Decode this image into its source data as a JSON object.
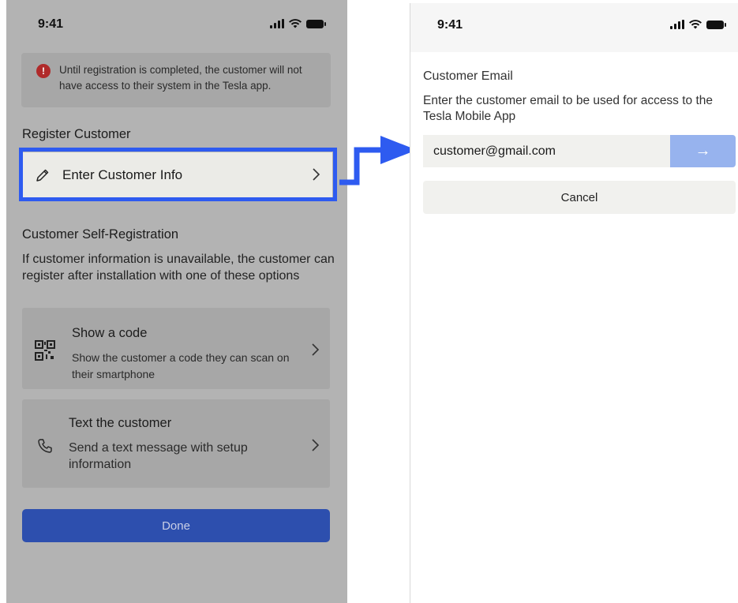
{
  "left_screen": {
    "status_time": "9:41",
    "alert": {
      "icon": "!",
      "text": "Until registration is completed, the customer will not have access to their system in the Tesla app."
    },
    "register_heading": "Register Customer",
    "enter_info_label": "Enter Customer Info",
    "self_heading": "Customer Self-Registration",
    "self_paragraph": "If customer information is unavailable, the customer can register after installation with one of these options",
    "options": [
      {
        "title": "Show a code",
        "description": "Show the customer a code they can scan on their smartphone",
        "icon": "qr-code-icon"
      },
      {
        "title": "Text the customer",
        "description": "Send a text message with setup information",
        "icon": "phone-icon"
      }
    ],
    "done_label": "Done"
  },
  "right_screen": {
    "status_time": "9:41",
    "title": "Customer Email",
    "subtitle": "Enter the customer email to be used for access to the Tesla Mobile App",
    "email_value": "customer@gmail.com",
    "submit_label": "→",
    "cancel_label": "Cancel"
  },
  "colors": {
    "highlight": "#2e5bf0",
    "done_button": "#2d4fae",
    "submit_button": "#97b3ee",
    "alert_icon": "#b02a2a"
  }
}
